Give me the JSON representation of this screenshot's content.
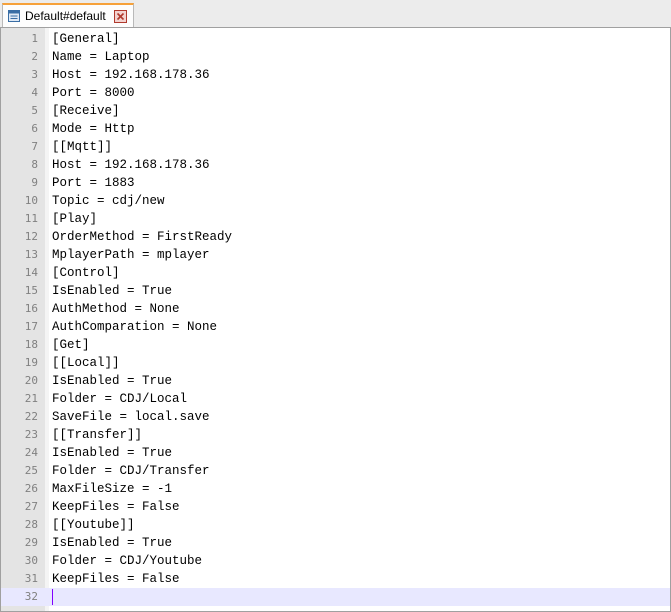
{
  "tab": {
    "title": "Default#default",
    "icon": "document-icon",
    "close_icon": "close-icon",
    "accent_color": "#f6a13a",
    "close_color": "#c0392b"
  },
  "editor": {
    "current_line": 32,
    "lines": [
      {
        "num": "1",
        "text": "[General]"
      },
      {
        "num": "2",
        "text": "Name = Laptop"
      },
      {
        "num": "3",
        "text": "Host = 192.168.178.36"
      },
      {
        "num": "4",
        "text": "Port = 8000"
      },
      {
        "num": "5",
        "text": "[Receive]"
      },
      {
        "num": "6",
        "text": "Mode = Http"
      },
      {
        "num": "7",
        "text": "[[Mqtt]]"
      },
      {
        "num": "8",
        "text": "Host = 192.168.178.36"
      },
      {
        "num": "9",
        "text": "Port = 1883"
      },
      {
        "num": "10",
        "text": "Topic = cdj/new"
      },
      {
        "num": "11",
        "text": "[Play]"
      },
      {
        "num": "12",
        "text": "OrderMethod = FirstReady"
      },
      {
        "num": "13",
        "text": "MplayerPath = mplayer"
      },
      {
        "num": "14",
        "text": "[Control]"
      },
      {
        "num": "15",
        "text": "IsEnabled = True"
      },
      {
        "num": "16",
        "text": "AuthMethod = None"
      },
      {
        "num": "17",
        "text": "AuthComparation = None"
      },
      {
        "num": "18",
        "text": "[Get]"
      },
      {
        "num": "19",
        "text": "[[Local]]"
      },
      {
        "num": "20",
        "text": "IsEnabled = True"
      },
      {
        "num": "21",
        "text": "Folder = CDJ/Local"
      },
      {
        "num": "22",
        "text": "SaveFile = local.save"
      },
      {
        "num": "23",
        "text": "[[Transfer]]"
      },
      {
        "num": "24",
        "text": "IsEnabled = True"
      },
      {
        "num": "25",
        "text": "Folder = CDJ/Transfer"
      },
      {
        "num": "26",
        "text": "MaxFileSize = -1"
      },
      {
        "num": "27",
        "text": "KeepFiles = False"
      },
      {
        "num": "28",
        "text": "[[Youtube]]"
      },
      {
        "num": "29",
        "text": "IsEnabled = True"
      },
      {
        "num": "30",
        "text": "Folder = CDJ/Youtube"
      },
      {
        "num": "31",
        "text": "KeepFiles = False"
      },
      {
        "num": "32",
        "text": ""
      }
    ]
  }
}
